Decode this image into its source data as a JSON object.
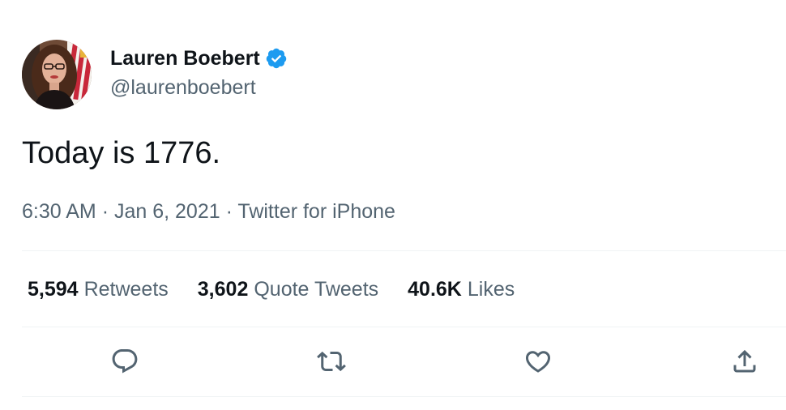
{
  "author": {
    "display_name": "Lauren Boebert",
    "handle": "@laurenboebert",
    "verified": true
  },
  "tweet": {
    "text": "Today is 1776.",
    "time": "6:30 AM",
    "separator": "·",
    "date": "Jan 6, 2021",
    "source": "Twitter for iPhone"
  },
  "stats": [
    {
      "value": "5,594",
      "label": "Retweets"
    },
    {
      "value": "3,602",
      "label": "Quote Tweets"
    },
    {
      "value": "40.6K",
      "label": "Likes"
    }
  ],
  "actions": [
    {
      "icon": "reply-icon"
    },
    {
      "icon": "retweet-icon"
    },
    {
      "icon": "like-icon"
    },
    {
      "icon": "share-icon"
    }
  ],
  "colors": {
    "text_primary": "#0f1419",
    "text_secondary": "#536471",
    "verified_blue": "#1d9bf0",
    "divider": "#eff3f4"
  }
}
